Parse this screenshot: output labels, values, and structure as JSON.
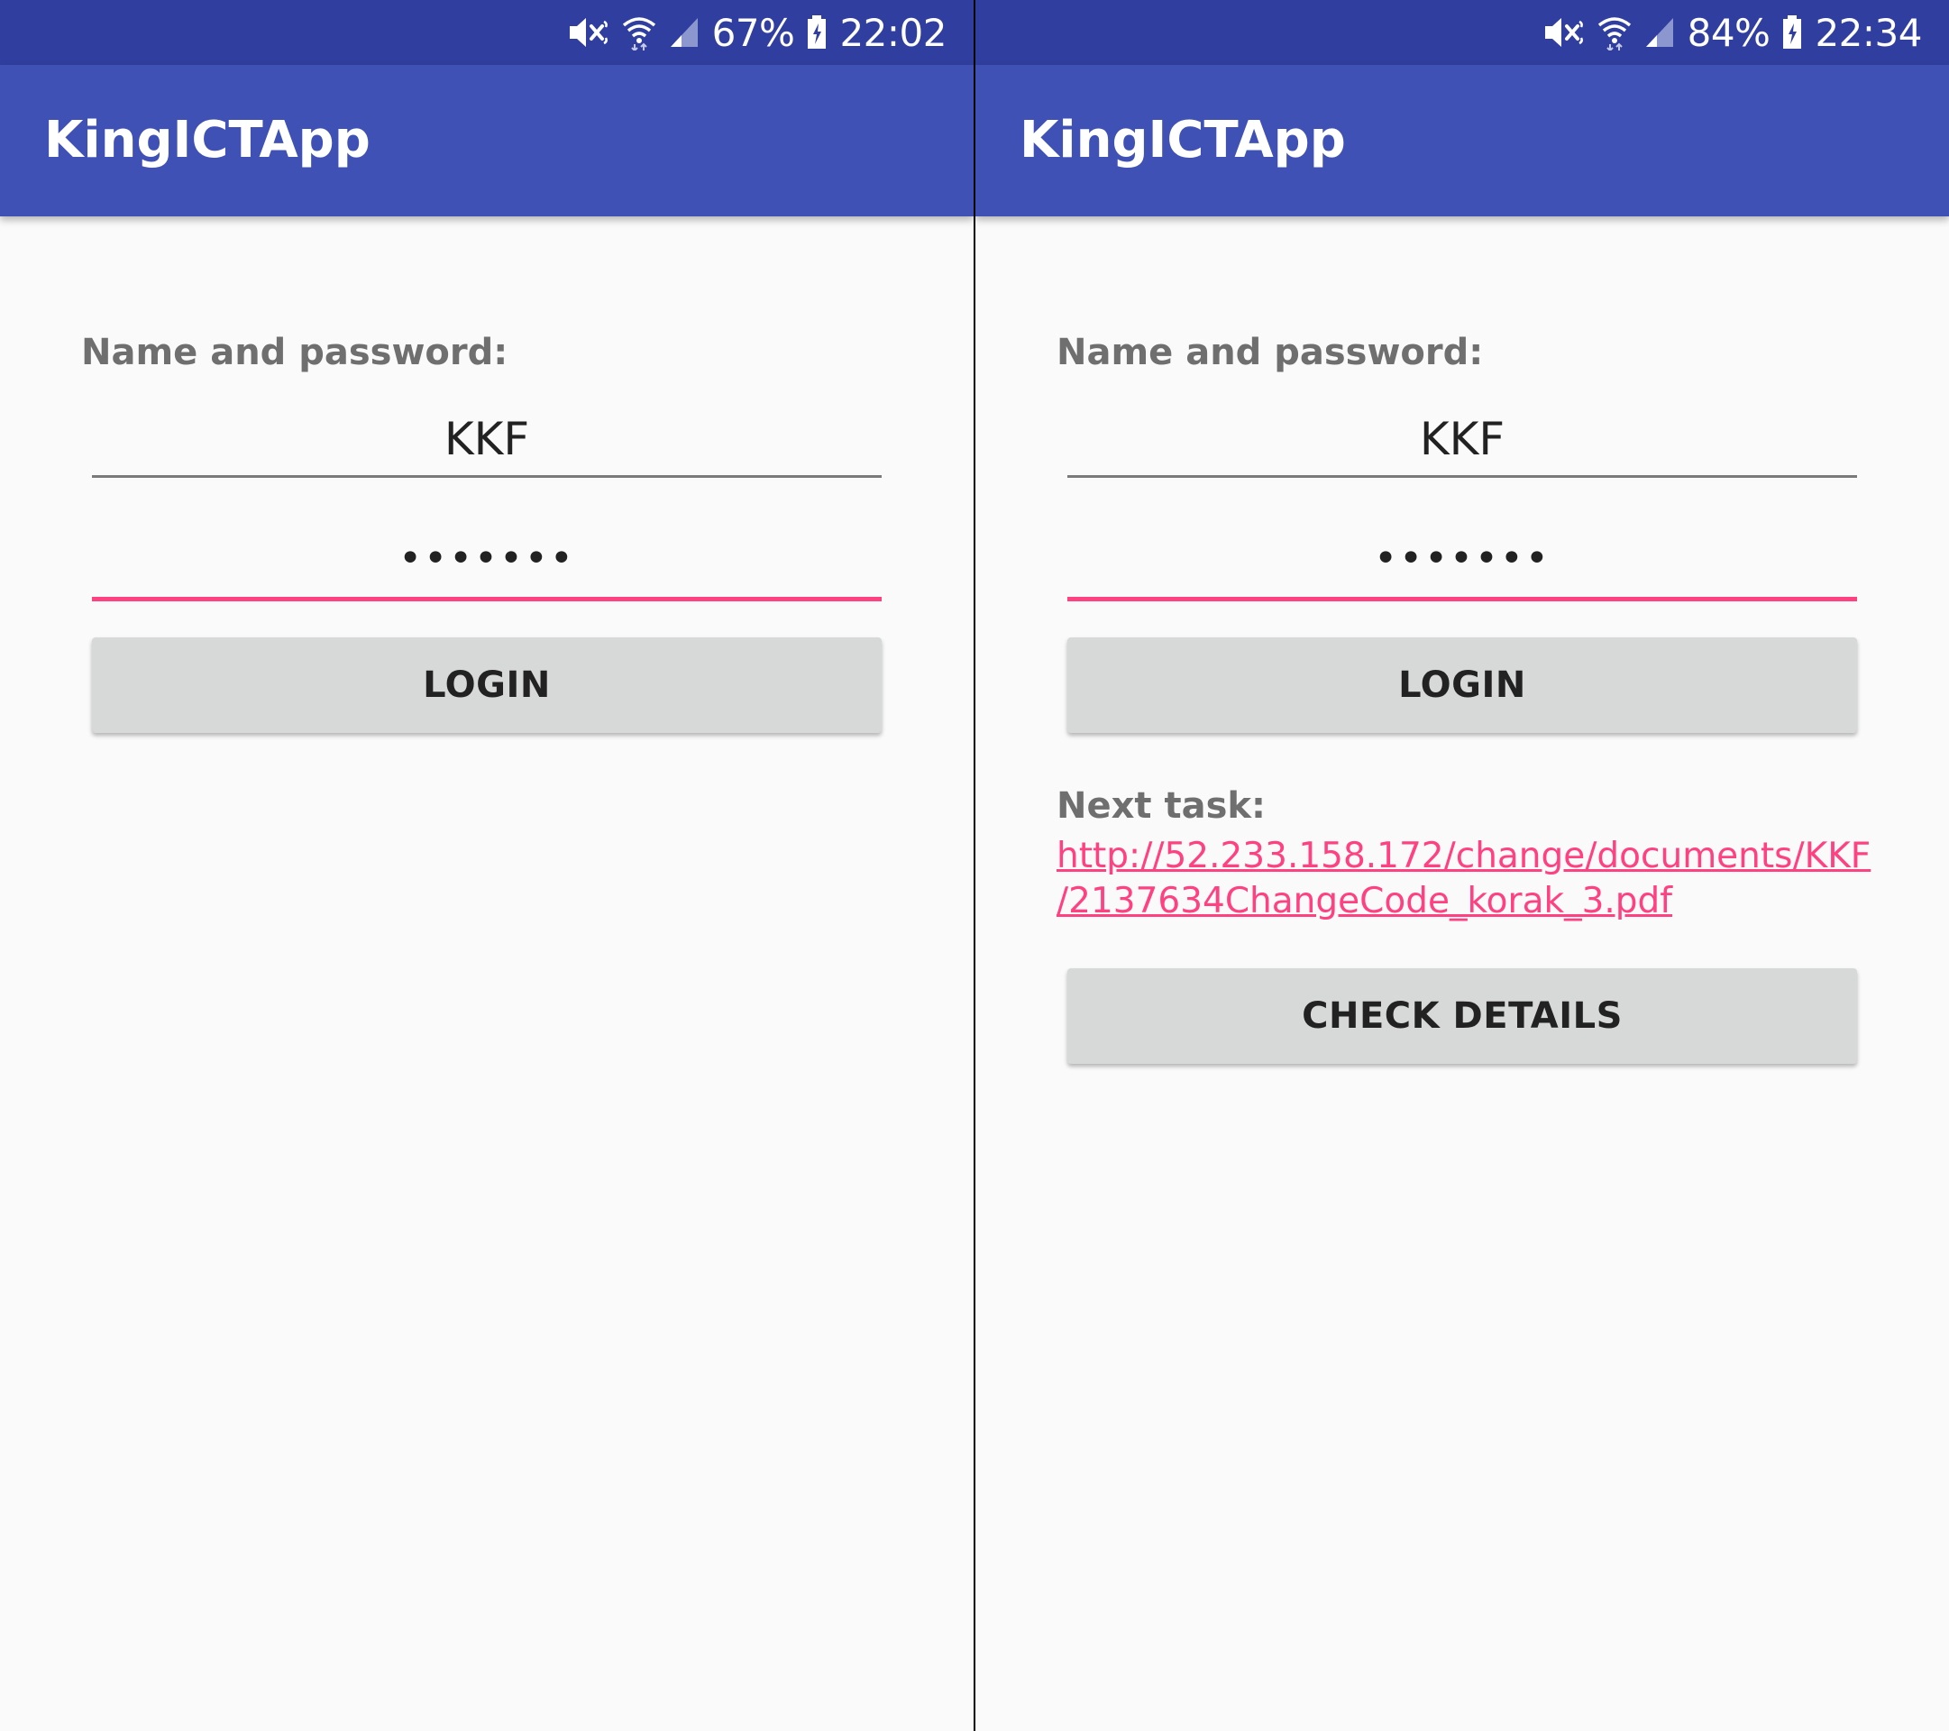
{
  "colors": {
    "status_bar": "#303f9f",
    "app_bar": "#3f51b5",
    "accent": "#ff4081",
    "button": "#d7d8d8",
    "background": "#fafafa"
  },
  "screens": [
    {
      "status_bar": {
        "icons": [
          "mute-icon",
          "wifi-icon",
          "signal-icon",
          "battery-icon"
        ],
        "battery": "67%",
        "time": "22:02"
      },
      "app_bar": {
        "title": "KingICTApp"
      },
      "form": {
        "label": "Name and password:",
        "name_value": "KKF",
        "password_value": "•••••••",
        "login_button": "LOGIN"
      }
    },
    {
      "status_bar": {
        "icons": [
          "mute-icon",
          "wifi-icon",
          "signal-icon",
          "battery-icon"
        ],
        "battery": "84%",
        "time": "22:34"
      },
      "app_bar": {
        "title": "KingICTApp"
      },
      "form": {
        "label": "Name and password:",
        "name_value": "KKF",
        "password_value": "•••••••",
        "login_button": "LOGIN"
      },
      "next_task": {
        "label": "Next task:",
        "link_line1": "http://52.233.158.172/change/documents/KKF",
        "link_line2": "/2137634ChangeCode_korak_3.pdf",
        "check_button": "CHECK DETAILS"
      }
    }
  ]
}
